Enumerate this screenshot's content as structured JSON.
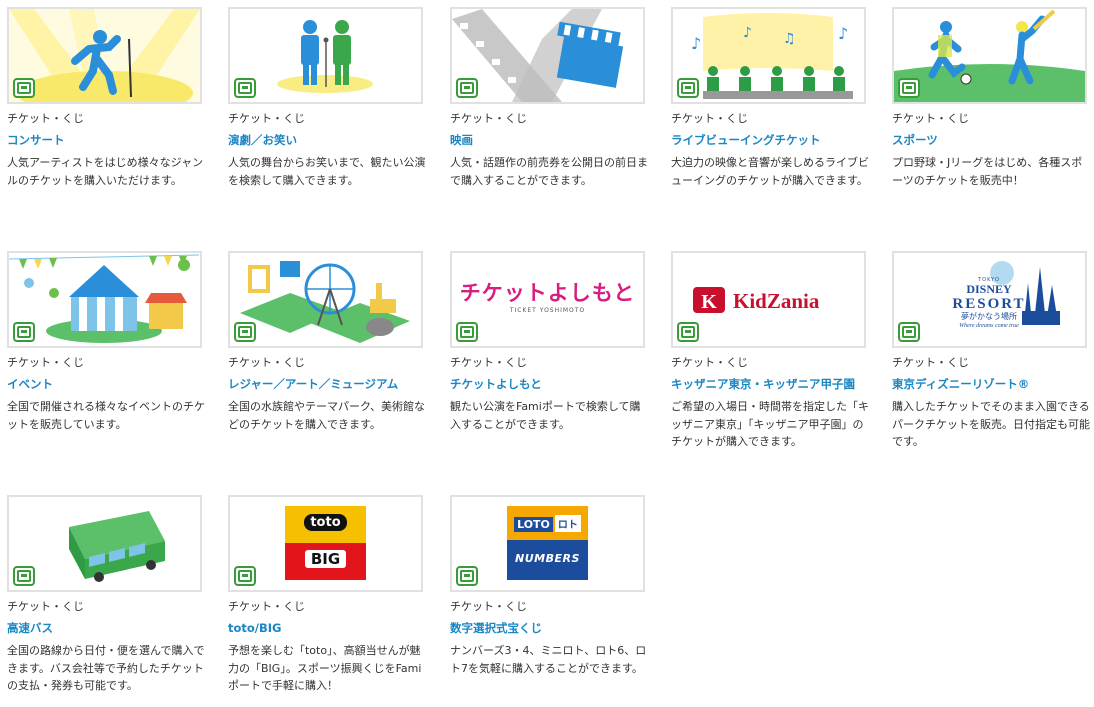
{
  "category_label": "チケット・くじ",
  "colors": {
    "title": "#1a86c4",
    "badge": "#3a9b3a",
    "border": "#e1e1e1"
  },
  "cards": [
    {
      "icon": "concert-singer-icon",
      "title": "コンサート",
      "desc": "人気アーティストをはじめ様々なジャンルのチケットを購入いただけます。"
    },
    {
      "icon": "comedy-duo-icon",
      "title": "演劇／お笑い",
      "desc": "人気の舞台からお笑いまで、観たい公演を検索して購入できます。"
    },
    {
      "icon": "film-clapperboard-icon",
      "title": "映画",
      "desc": "人気・話題作の前売券を公開日の前日まで購入することができます。"
    },
    {
      "icon": "live-viewing-icon",
      "title": "ライブビューイングチケット",
      "desc": "大迫力の映像と音響が楽しめるライブビューイングのチケットが購入できます。"
    },
    {
      "icon": "sports-players-icon",
      "title": "スポーツ",
      "desc": "プロ野球・Jリーグをはじめ、各種スポーツのチケットを販売中！"
    },
    {
      "icon": "event-tent-icon",
      "title": "イベント",
      "desc": "全国で開催される様々なイベントのチケットを販売しています。"
    },
    {
      "icon": "leisure-ferris-wheel-icon",
      "title": "レジャー／アート／ミュージアム",
      "desc": "全国の水族館やテーマパーク、美術館などのチケットを購入できます。"
    },
    {
      "icon": "yoshimoto-logo",
      "logo_text": "チケットよしもと",
      "logo_sub": "TICKET YOSHIMOTO",
      "title": "チケットよしもと",
      "desc": "観たい公演をFamiポートで検索して購入することができます。"
    },
    {
      "icon": "kidzania-logo",
      "logo_text": "KidZania",
      "title": "キッザニア東京・キッザニア甲子園",
      "desc": "ご希望の入場日・時間帯を指定した「キッザニア東京」「キッザニア甲子園」のチケットが購入できます。"
    },
    {
      "icon": "tokyo-disney-resort-logo",
      "logo_top": "TOKYO",
      "logo_main": "DISNEY",
      "logo_resort": "RESORT",
      "logo_tag": "夢がかなう場所",
      "logo_en": "Where dreams come true",
      "title": "東京ディズニーリゾート®",
      "desc": "購入したチケットでそのまま入園できるパークチケットを販売。日付指定も可能です。"
    },
    {
      "icon": "highway-bus-icon",
      "title": "高速バス",
      "desc": "全国の路線から日付・便を選んで購入できます。バス会社等で予約したチケットの支払・発券も可能です。"
    },
    {
      "icon": "toto-big-logo",
      "logo_top": "toto",
      "logo_bottom": "BIG",
      "title": "toto/BIG",
      "desc": "予想を楽しむ「toto」、高額当せんが魅力の「BIG」。スポーツ振興くじをFamiポートで手軽に購入！"
    },
    {
      "icon": "loto-numbers-logo",
      "logo_top": "LOTO",
      "logo_top2": "ロト",
      "logo_bottom": "NUMBERS",
      "title": "数字選択式宝くじ",
      "desc": "ナンバーズ3・4、ミニロト、ロト6、ロト7を気軽に購入することができます。"
    }
  ]
}
